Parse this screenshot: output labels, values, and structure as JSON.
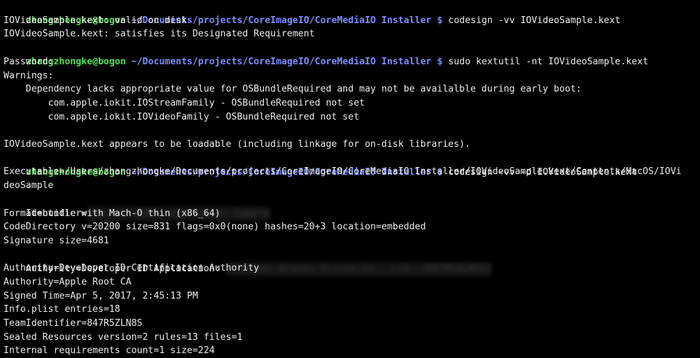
{
  "prompt": {
    "user_host": "zhangzhongke@bogon",
    "path": "~/Documents/projects/CoreImageIO/CoreMediaIO Installer",
    "symbol": "$"
  },
  "commands": [
    "codesign -vv IOVideoSample.kext",
    "sudo kextutil -nt IOVideoSample.kext",
    "codesign -vv -d IOVideoSample.kext"
  ],
  "output": {
    "valid_on_disk": "IOVideoSample.kext: valid on disk",
    "satisfies_requirement": "IOVideoSample.kext: satisfies its Designated Requirement",
    "password": "Password:",
    "warnings": "Warnings:",
    "dependency_lacks": "    Dependency lacks appropriate value for OSBundleRequired and may not be availalble during early boot:",
    "iostreamfamily": "        com.apple.iokit.IOStreamFamily - OSBundleRequired not set",
    "iovideofamily": "        com.apple.iokit.IOVideoFamily - OSBundleRequired not set",
    "loadable": "IOVideoSample.kext appears to be loadable (including linkage for on-disk libraries).",
    "executable_1": "Executable=/Users/zhangzhongke/Documents/projects/CoreImageIO/CoreMediaIO Installer/IOVideoSample.kext/Contents/MacOS/IOVi",
    "executable_2": "deoSample",
    "identifier_label": "Identifier=",
    "identifier_redacted": "com.inste360.cmio.driver.Sample",
    "format": "Format=bundle with Mach-O thin (x86_64)",
    "codedirectory": "CodeDirectory v=20200 size=831 flags=0x0(none) hashes=20+3 location=embedded",
    "signature_size": "Signature size=4681",
    "authority_app_label": "Authority=Developer ID Application: ",
    "authority_app_redacted": "Shenzhen Arashi Vision Co., Ltd. (847R5ZLN8S)",
    "authority_cert": "Authority=Developer ID Certification Authority",
    "authority_root": "Authority=Apple Root CA",
    "signed_time": "Signed Time=Apr 5, 2017, 2:45:13 PM",
    "info_plist": "Info.plist entries=18",
    "team_identifier": "TeamIdentifier=847R5ZLN8S",
    "sealed_resources": "Sealed Resources version=2 rules=13 files=1",
    "internal_requirements": "Internal requirements count=1 size=224"
  },
  "colors": {
    "background": "#000000",
    "text": "#ececec",
    "user_host": "#4fe04f",
    "path": "#7b8cff"
  }
}
